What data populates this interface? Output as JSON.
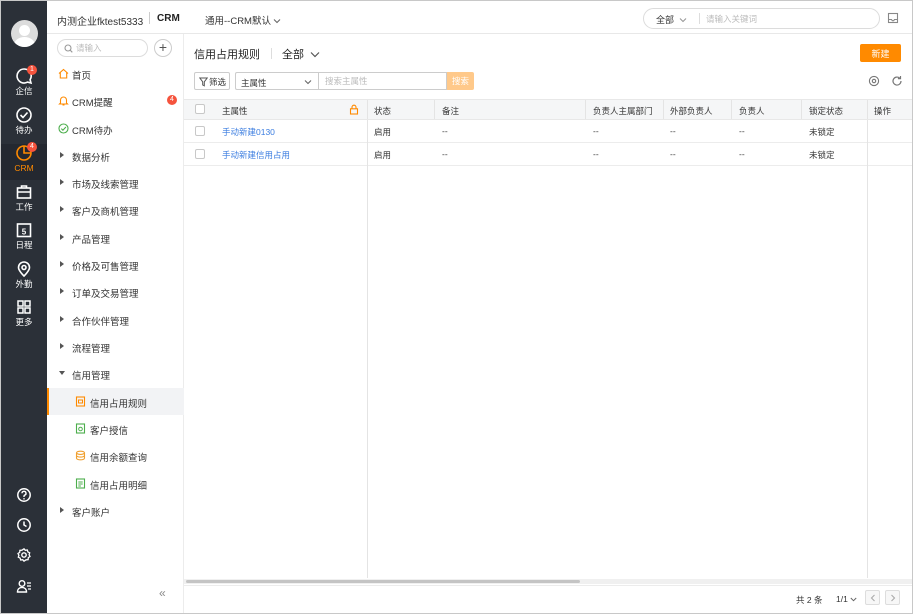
{
  "header": {
    "company": "内测企业fktest5333",
    "app": "CRM",
    "view": "通用--CRM默认",
    "search_scope": "全部",
    "search_placeholder": "请输入关键词"
  },
  "rail": {
    "items": [
      {
        "label": "企信",
        "icon": "chat-icon",
        "badge": "1"
      },
      {
        "label": "待办",
        "icon": "check-circle-icon",
        "badge": ""
      },
      {
        "label": "CRM",
        "icon": "crm-pie-icon",
        "badge": "4"
      },
      {
        "label": "工作",
        "icon": "briefcase-icon",
        "badge": ""
      },
      {
        "label": "日程",
        "icon": "calendar-icon",
        "badge": "",
        "day": "5"
      },
      {
        "label": "外勤",
        "icon": "location-pin-icon",
        "badge": ""
      },
      {
        "label": "更多",
        "icon": "grid-icon",
        "badge": ""
      }
    ],
    "bottom_icons": [
      "help-icon",
      "clock-icon",
      "settings-icon",
      "user-list-icon"
    ],
    "accent": "#ff8a00"
  },
  "sidebar": {
    "search_placeholder": "请输入",
    "items": [
      {
        "label": "首页",
        "icon": "home-icon"
      },
      {
        "label": "CRM提醒",
        "icon": "bell-icon",
        "badge": "4"
      },
      {
        "label": "CRM待办",
        "icon": "check-circle-icon"
      },
      {
        "label": "数据分析"
      },
      {
        "label": "市场及线索管理"
      },
      {
        "label": "客户及商机管理"
      },
      {
        "label": "产品管理"
      },
      {
        "label": "价格及可售管理"
      },
      {
        "label": "订单及交易管理"
      },
      {
        "label": "合作伙伴管理"
      },
      {
        "label": "流程管理"
      },
      {
        "label": "信用管理"
      },
      {
        "label": "信用占用规则",
        "icon": "rule-doc-icon"
      },
      {
        "label": "客户授信",
        "icon": "credit-doc-icon"
      },
      {
        "label": "信用余额查询",
        "icon": "database-icon"
      },
      {
        "label": "信用占用明细",
        "icon": "detail-doc-icon"
      },
      {
        "label": "客户账户"
      }
    ]
  },
  "main": {
    "title": "信用占用规则",
    "scope": "全部",
    "new_label": "新建",
    "filter_label": "筛选",
    "field_select": "主属性",
    "search_placeholder": "搜索主属性",
    "search_label": "搜索",
    "columns": [
      "主属性",
      "状态",
      "备注",
      "负责人主属部门",
      "外部负责人",
      "负责人",
      "锁定状态",
      "操作"
    ],
    "rows": [
      [
        "手动新建0130",
        "启用",
        "--",
        "--",
        "--",
        "--",
        "未锁定"
      ],
      [
        "手动新建信用占用",
        "启用",
        "--",
        "--",
        "--",
        "--",
        "未锁定"
      ]
    ],
    "total": "共 2 条",
    "page": "1/1"
  }
}
